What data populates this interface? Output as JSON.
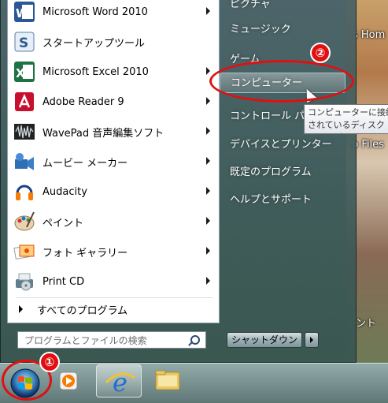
{
  "programs": [
    {
      "label": "Microsoft Word 2010",
      "icon": "word-icon",
      "submenu": true
    },
    {
      "label": "スタートアップツール",
      "icon": "startup-tool-icon",
      "submenu": false
    },
    {
      "label": "Microsoft Excel 2010",
      "icon": "excel-icon",
      "submenu": true
    },
    {
      "label": "Adobe Reader 9",
      "icon": "adobe-reader-icon",
      "submenu": true
    },
    {
      "label": "WavePad 音声編集ソフト",
      "icon": "wavepad-icon",
      "submenu": true
    },
    {
      "label": "ムービー メーカー",
      "icon": "movie-maker-icon",
      "submenu": true
    },
    {
      "label": "Audacity",
      "icon": "audacity-icon",
      "submenu": true
    },
    {
      "label": "ペイント",
      "icon": "paint-icon",
      "submenu": true
    },
    {
      "label": "フォト ギャラリー",
      "icon": "photo-gallery-icon",
      "submenu": true
    },
    {
      "label": "Print CD",
      "icon": "print-cd-icon",
      "submenu": true
    }
  ],
  "all_programs": "すべてのプログラム",
  "search_placeholder": "プログラムとファイルの検索",
  "right_pane": {
    "top_cut": "ピクチャ",
    "music": "ミュージック",
    "games": "ゲーム",
    "computer": "コンピューター",
    "control_panel": "コントロール パネル",
    "devices": "デバイスとプリンター",
    "default_programs": "既定のプログラム",
    "help": "ヘルプとサポート"
  },
  "shutdown": "シャットダウン",
  "tooltip": "コンピューターに接続されているディスク ドライブやその他のハードウェアを参照します。",
  "wallpaper": {
    "text1": "s Hom",
    "text2": "p Files",
    "text3": "ント"
  },
  "annotations": [
    "①",
    "②"
  ],
  "colors": {
    "highlight_red": "#e01010",
    "word_blue": "#2b5797",
    "excel_green": "#1f7244",
    "adobe_red": "#c8102e"
  }
}
